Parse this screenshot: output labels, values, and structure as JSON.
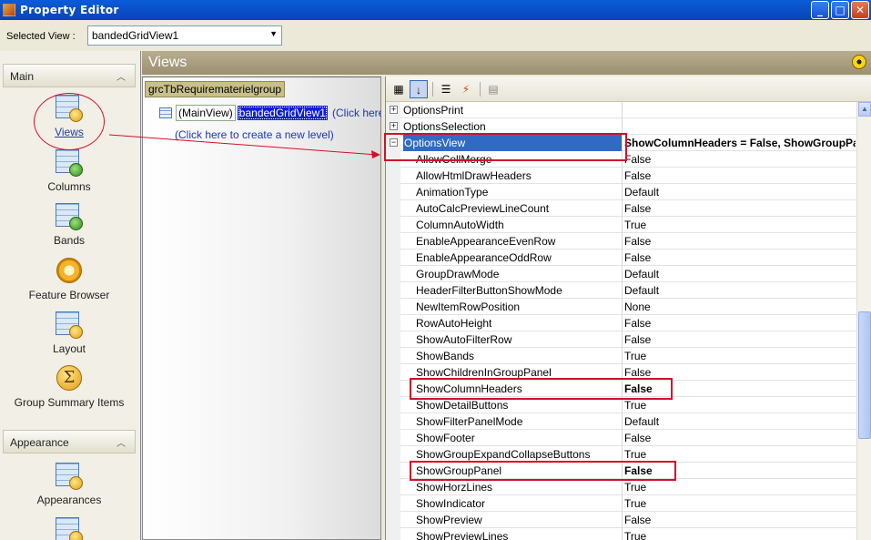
{
  "window": {
    "title": "Property Editor",
    "buttons": {
      "minimize": "_",
      "maximize": "□",
      "close": "✕"
    }
  },
  "topbar": {
    "selected_view_label": "Selected View :",
    "selected_view_value": "bandedGridView1"
  },
  "nav": {
    "group_main": "Main",
    "group_appearance": "Appearance",
    "items": [
      {
        "label": "Views"
      },
      {
        "label": "Columns"
      },
      {
        "label": "Bands"
      },
      {
        "label": "Feature Browser"
      },
      {
        "label": "Layout"
      },
      {
        "label": "Group Summary Items"
      },
      {
        "label": "Appearances"
      }
    ]
  },
  "views_header": {
    "title": "Views"
  },
  "tree": {
    "root": "grcTbRequirematerielgroup",
    "mainview": "(MainView)",
    "selected": "bandedGridView1",
    "click_here": "(Click here",
    "create_level": "(Click here to create a new level)"
  },
  "toolbar_icons": [
    "categorized-icon",
    "alphabetical-icon",
    "properties-icon",
    "events-icon",
    "property-pages-icon"
  ],
  "properties": [
    {
      "name": "OptionsPrint",
      "value": "",
      "type": "category",
      "expander": "+"
    },
    {
      "name": "OptionsSelection",
      "value": "",
      "type": "category",
      "expander": "+"
    },
    {
      "name": "OptionsView",
      "value": "ShowColumnHeaders = False, ShowGroupPanel = False",
      "type": "category",
      "expander": "−",
      "selected": true,
      "bold": true
    },
    {
      "name": "AllowCellMerge",
      "value": "False",
      "type": "child"
    },
    {
      "name": "AllowHtmlDrawHeaders",
      "value": "False",
      "type": "child"
    },
    {
      "name": "AnimationType",
      "value": "Default",
      "type": "child"
    },
    {
      "name": "AutoCalcPreviewLineCount",
      "value": "False",
      "type": "child"
    },
    {
      "name": "ColumnAutoWidth",
      "value": "True",
      "type": "child"
    },
    {
      "name": "EnableAppearanceEvenRow",
      "value": "False",
      "type": "child"
    },
    {
      "name": "EnableAppearanceOddRow",
      "value": "False",
      "type": "child"
    },
    {
      "name": "GroupDrawMode",
      "value": "Default",
      "type": "child"
    },
    {
      "name": "HeaderFilterButtonShowMode",
      "value": "Default",
      "type": "child"
    },
    {
      "name": "NewItemRowPosition",
      "value": "None",
      "type": "child"
    },
    {
      "name": "RowAutoHeight",
      "value": "False",
      "type": "child"
    },
    {
      "name": "ShowAutoFilterRow",
      "value": "False",
      "type": "child"
    },
    {
      "name": "ShowBands",
      "value": "True",
      "type": "child"
    },
    {
      "name": "ShowChildrenInGroupPanel",
      "value": "False",
      "type": "child"
    },
    {
      "name": "ShowColumnHeaders",
      "value": "False",
      "type": "child",
      "bold": true
    },
    {
      "name": "ShowDetailButtons",
      "value": "True",
      "type": "child"
    },
    {
      "name": "ShowFilterPanelMode",
      "value": "Default",
      "type": "child"
    },
    {
      "name": "ShowFooter",
      "value": "False",
      "type": "child"
    },
    {
      "name": "ShowGroupExpandCollapseButtons",
      "value": "True",
      "type": "child"
    },
    {
      "name": "ShowGroupPanel",
      "value": "False",
      "type": "child",
      "bold": true
    },
    {
      "name": "ShowHorzLines",
      "value": "True",
      "type": "child"
    },
    {
      "name": "ShowIndicator",
      "value": "True",
      "type": "child"
    },
    {
      "name": "ShowPreview",
      "value": "False",
      "type": "child"
    },
    {
      "name": "ShowPreviewLines",
      "value": "True",
      "type": "child"
    }
  ],
  "colors": {
    "annotation_red": "#d1102a",
    "selection_blue": "#316ac5",
    "title_blue": "#0a5cd8"
  }
}
